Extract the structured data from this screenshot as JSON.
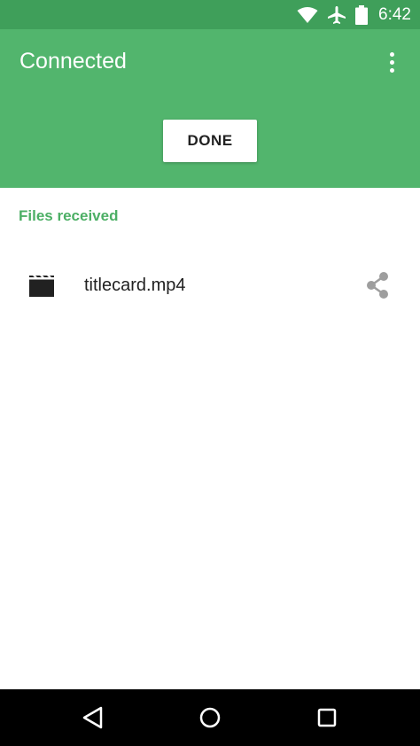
{
  "status_bar": {
    "time": "6:42",
    "icons": [
      "wifi-icon",
      "airplane-icon",
      "battery-icon"
    ]
  },
  "app_bar": {
    "title": "Connected",
    "done_label": "DONE",
    "background": "#52b56d"
  },
  "content": {
    "section_header": "Files received",
    "files": [
      {
        "name": "titlecard.mp4",
        "icon": "movie-clapper-icon",
        "action_icon": "share-icon"
      }
    ]
  },
  "nav_bar": {
    "buttons": [
      "back-icon",
      "home-icon",
      "recents-icon"
    ]
  },
  "colors": {
    "status_bar": "#3f9f5a",
    "accent": "#4caf65",
    "text_primary": "#212121",
    "icon_muted": "#9e9e9e"
  }
}
